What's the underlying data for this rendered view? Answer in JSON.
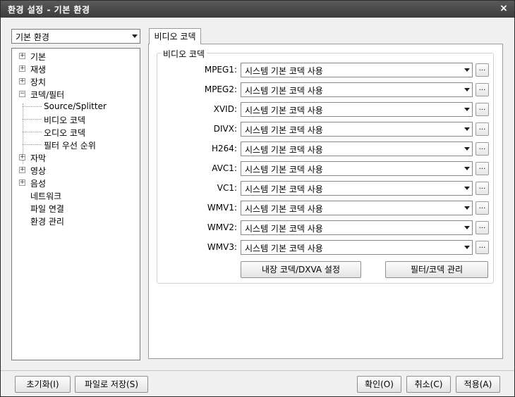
{
  "window": {
    "title": "환경 설정 - 기본 환경",
    "close_glyph": "×"
  },
  "preset": {
    "value": "기본 환경"
  },
  "tree": {
    "items": [
      {
        "label": "기본",
        "expander": "+"
      },
      {
        "label": "재생",
        "expander": "+"
      },
      {
        "label": "장치",
        "expander": "+"
      },
      {
        "label": "코덱/필터",
        "expander": "−"
      },
      {
        "label": "Source/Splitter"
      },
      {
        "label": "비디오 코덱"
      },
      {
        "label": "오디오 코덱"
      },
      {
        "label": "필터 우선 순위"
      },
      {
        "label": "자막",
        "expander": "+"
      },
      {
        "label": "영상",
        "expander": "+"
      },
      {
        "label": "음성",
        "expander": "+"
      },
      {
        "label": "네트워크"
      },
      {
        "label": "파일 연결"
      },
      {
        "label": "환경 관리"
      }
    ]
  },
  "tab": {
    "label": "비디오 코덱"
  },
  "group": {
    "title": "비디오 코덱"
  },
  "codecs": [
    {
      "label": "MPEG1:",
      "value": "시스템 기본 코덱 사용"
    },
    {
      "label": "MPEG2:",
      "value": "시스템 기본 코덱 사용"
    },
    {
      "label": "XVID:",
      "value": "시스템 기본 코덱 사용"
    },
    {
      "label": "DIVX:",
      "value": "시스템 기본 코덱 사용"
    },
    {
      "label": "H264:",
      "value": "시스템 기본 코덱 사용"
    },
    {
      "label": "AVC1:",
      "value": "시스템 기본 코덱 사용"
    },
    {
      "label": "VC1:",
      "value": "시스템 기본 코덱 사용"
    },
    {
      "label": "WMV1:",
      "value": "시스템 기본 코덱 사용"
    },
    {
      "label": "WMV2:",
      "value": "시스템 기본 코덱 사용"
    },
    {
      "label": "WMV3:",
      "value": "시스템 기본 코덱 사용"
    }
  ],
  "more_glyph": "...",
  "buttons": {
    "internal_codec": "내장 코덱/DXVA 설정",
    "filter_manage": "필터/코덱 관리",
    "reset": "초기화(I)",
    "save_file": "파일로 저장(S)",
    "ok": "확인(O)",
    "cancel": "취소(C)",
    "apply": "적용(A)"
  }
}
